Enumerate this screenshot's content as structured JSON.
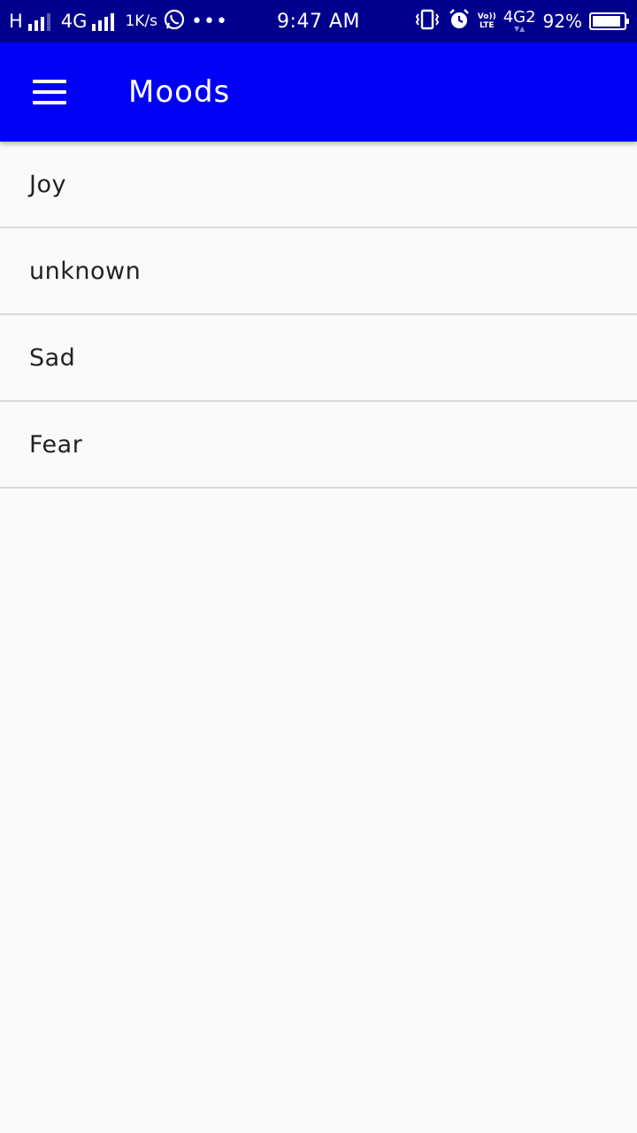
{
  "status_bar": {
    "carrier1_type": "H",
    "carrier2_type": "4G",
    "speed": "1K/s",
    "notification_icon": "whatsapp-icon",
    "more": "•••",
    "time": "9:47 AM",
    "volte_top": "Vo))",
    "volte_bottom": "LTE",
    "network": "4G2",
    "battery_percent": "92%",
    "battery_level": 0.92
  },
  "app_bar": {
    "menu_icon": "hamburger-menu-icon",
    "title": "Moods",
    "color": "#0000f5"
  },
  "moods": {
    "items": [
      {
        "label": "Joy"
      },
      {
        "label": "unknown"
      },
      {
        "label": "Sad"
      },
      {
        "label": "Fear"
      }
    ]
  }
}
